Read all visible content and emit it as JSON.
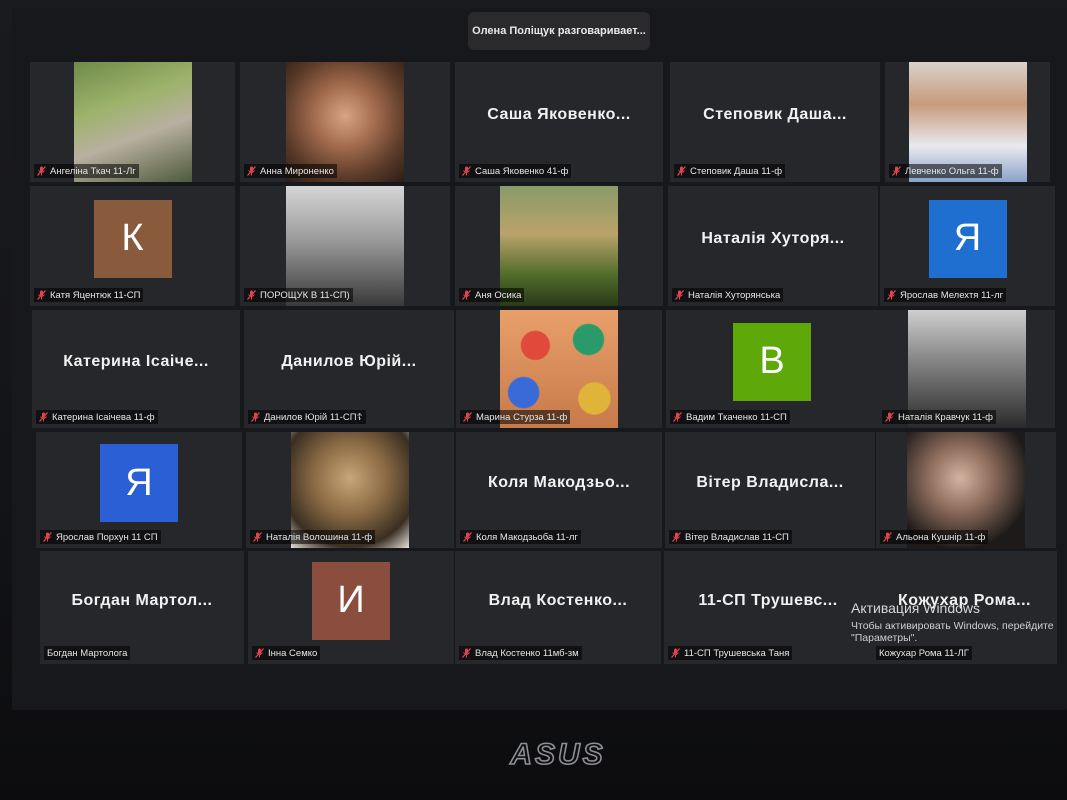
{
  "speaking_banner": "Олена Поліщук разговаривает...",
  "colors": {
    "tile_bg": "#26272a",
    "avatar_k": "#8a5a3c",
    "avatar_ya1": "#1f6fd1",
    "avatar_b": "#5ea80a",
    "avatar_ya2": "#2a5fd6",
    "avatar_i": "#8a4e3e",
    "mic_muted": "#e0464b"
  },
  "participants": [
    {
      "label": "Ангеліна Ткач 11-Лг",
      "type": "photo",
      "icon": "person-photo-park"
    },
    {
      "label": "Анна Мироненко",
      "type": "photo",
      "icon": "person-photo-portrait"
    },
    {
      "label": "Саша Яковенко 41-ф",
      "type": "name",
      "display": "Саша Яковенко..."
    },
    {
      "label": "Степовик Даша 11-ф",
      "type": "name",
      "display": "Степовик Даша..."
    },
    {
      "label": "Левченко Ольга 11-ф",
      "type": "photo",
      "icon": "person-photo-embroidered"
    },
    {
      "label": "Катя Яцентюк 11-СП",
      "type": "avatar",
      "letter": "К"
    },
    {
      "label": "ПОРОЩУК В 11-СП)",
      "type": "photo",
      "icon": "person-photo-bw"
    },
    {
      "label": "Аня Осика",
      "type": "photo",
      "icon": "person-photo-grass"
    },
    {
      "label": "Наталія Хуторянська",
      "type": "name",
      "display": "Наталія Хуторя..."
    },
    {
      "label": "Ярослав Мелехтя 11-лг",
      "type": "avatar",
      "letter": "Я"
    },
    {
      "label": "Катерина Ісаічева 11-ф",
      "type": "name",
      "display": "Катерина Ісаіче..."
    },
    {
      "label": "Данилов Юрій 11-СП☦",
      "type": "name",
      "display": "Данилов Юрій..."
    },
    {
      "label": "Марина Стурза 11-ф",
      "type": "photo",
      "icon": "balloons-18-photo"
    },
    {
      "label": "Вадим Ткаченко 11-СП",
      "type": "avatar",
      "letter": "В"
    },
    {
      "label": "Наталія Кравчук 11-ф",
      "type": "photo",
      "icon": "person-photo-bw-portrait"
    },
    {
      "label": "Ярослав Порхун 11 СП",
      "type": "avatar",
      "letter": "Я"
    },
    {
      "label": "Наталія Волошина 11-ф",
      "type": "photo",
      "icon": "dog-photo"
    },
    {
      "label": "Коля Макодзьоба 11-лг",
      "type": "name",
      "display": "Коля Макодзьо..."
    },
    {
      "label": "Вітер Владислав 11-СП",
      "type": "name",
      "display": "Вітер Владисла..."
    },
    {
      "label": "Альона Кушнір 11-ф",
      "type": "photo",
      "icon": "person-photo-dark"
    },
    {
      "label": "Богдан Мартолога",
      "type": "name",
      "display": "Богдан Мартол...",
      "unmuted": true
    },
    {
      "label": "Інна Семко",
      "type": "avatar",
      "letter": "И"
    },
    {
      "label": "Влад Костенко 11мб-зм",
      "type": "name",
      "display": "Влад Костенко..."
    },
    {
      "label": "11-СП Трушевська Таня",
      "type": "name",
      "display": "11-СП Трушевс..."
    },
    {
      "label": "Кожухар Рома 11-ЛГ",
      "type": "name",
      "display": "Кожухар Рома...",
      "unmuted": true
    }
  ],
  "windows_activation": {
    "title": "Активация Windows",
    "line1": "Чтобы активировать Windows, перейдите",
    "line2": "\"Параметры\"."
  },
  "laptop_brand": "ASUS"
}
